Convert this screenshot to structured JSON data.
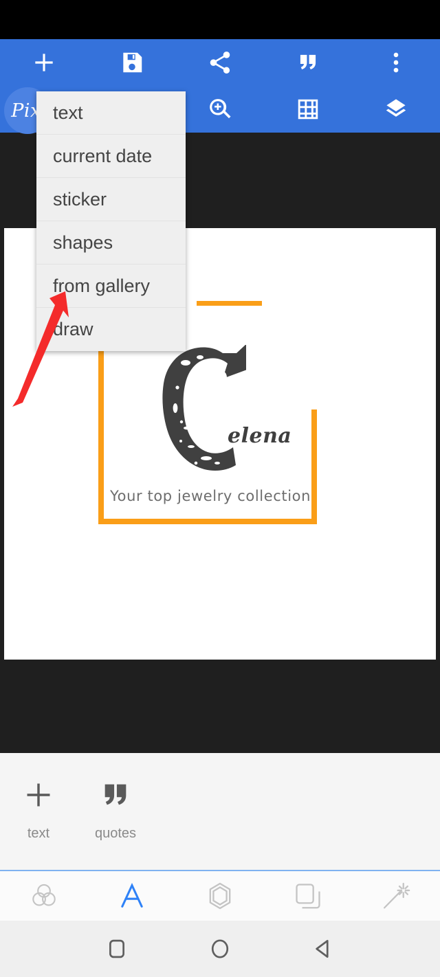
{
  "app": {
    "name": "Pix",
    "logo_badge_text": "Pix",
    "accent_blue": "#3572DB",
    "panel_gray": "#F5F5F5",
    "editor_dark": "#1f1f1f",
    "tab_active_blue": "#2F82F7",
    "annotation_red": "#F42B2B"
  },
  "status_bar": {
    "background": "#000000"
  },
  "toolbar": {
    "row1": [
      {
        "name": "add-button",
        "icon": "plus-icon",
        "label": "add"
      },
      {
        "name": "save-button",
        "icon": "save-disk-icon",
        "label": "save"
      },
      {
        "name": "share-button",
        "icon": "share-icon",
        "label": "share"
      },
      {
        "name": "quotes-button",
        "icon": "quote-icon",
        "label": "quotes"
      },
      {
        "name": "overflow-button",
        "icon": "more-vertical-icon",
        "label": "more"
      }
    ],
    "row2": [
      {
        "name": "zoom-button",
        "icon": "zoom-in-icon",
        "label": "zoom"
      },
      {
        "name": "grid-button",
        "icon": "grid-icon",
        "label": "grid"
      },
      {
        "name": "layers-button",
        "icon": "layers-icon",
        "label": "layers"
      }
    ]
  },
  "menu": {
    "open": true,
    "items": [
      {
        "label": "text"
      },
      {
        "label": "current date"
      },
      {
        "label": "sticker"
      },
      {
        "label": "shapes"
      },
      {
        "label": "from gallery"
      },
      {
        "label": "draw"
      }
    ]
  },
  "annotation": {
    "type": "arrow",
    "color": "#F42B2B",
    "points_to": "from gallery"
  },
  "canvas": {
    "background": "#ffffff",
    "frame_color": "#FA9E18",
    "artwork": {
      "monogram": "C",
      "script_word": "elena",
      "tagline": "Your top jewelry collection"
    }
  },
  "tool_panel": {
    "items": [
      {
        "label": "text",
        "icon": "plus-icon"
      },
      {
        "label": "quotes",
        "icon": "quote-icon"
      }
    ]
  },
  "tabbar": {
    "active_index": 1,
    "items": [
      {
        "name": "tab-blend",
        "icon": "three-circles-icon",
        "active": false
      },
      {
        "name": "tab-text",
        "icon": "letter-a-icon",
        "active": true
      },
      {
        "name": "tab-shapes",
        "icon": "hexagon-icon",
        "active": false
      },
      {
        "name": "tab-layers",
        "icon": "copy-layers-icon",
        "active": false
      },
      {
        "name": "tab-effects",
        "icon": "magic-wand-icon",
        "active": false
      }
    ]
  },
  "navbar": {
    "items": [
      {
        "name": "nav-recents",
        "icon": "square-icon"
      },
      {
        "name": "nav-home",
        "icon": "circle-icon"
      },
      {
        "name": "nav-back",
        "icon": "triangle-back-icon"
      }
    ]
  }
}
